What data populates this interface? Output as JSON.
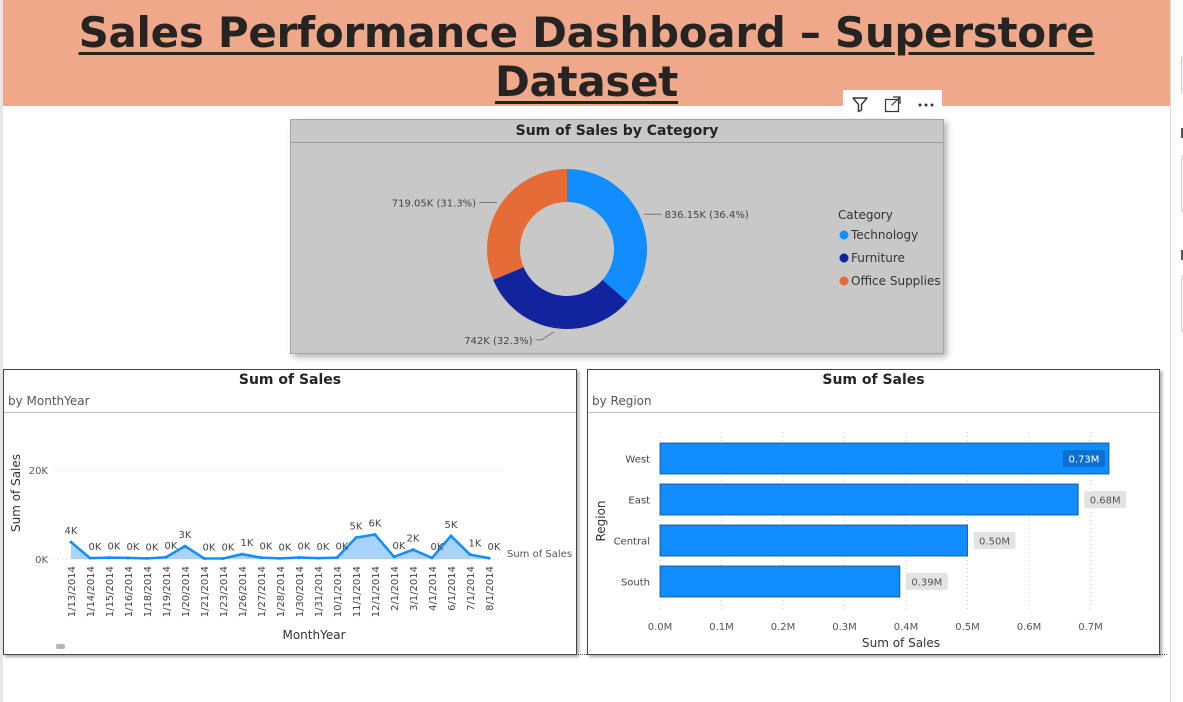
{
  "dashboard": {
    "title": "Sales Performance Dashboard – Superstore Dataset"
  },
  "colors": {
    "header": "#f0a88b",
    "technology": "#118dff",
    "furniture": "#12239e",
    "office_supplies": "#e66c37",
    "bar": "#118dff",
    "line_area": "#a9d3fb"
  },
  "toolbar": {
    "icons": [
      "filter-icon",
      "focus-mode-icon",
      "more-options-icon"
    ]
  },
  "chart_data": [
    {
      "type": "pie",
      "variant": "donut",
      "title": "Sum of Sales by Category",
      "legend": {
        "title": "Category",
        "placement": "right"
      },
      "slices": [
        {
          "name": "Technology",
          "value": 836.15,
          "display": "836.15K (36.4%)",
          "color": "#118dff"
        },
        {
          "name": "Furniture",
          "value": 742,
          "display": "742K (32.3%)",
          "color": "#12239e"
        },
        {
          "name": "Office Supplies",
          "value": 719.05,
          "display": "719.05K (31.3%)",
          "color": "#e66c37"
        }
      ]
    },
    {
      "type": "area",
      "title": "Sum of Sales",
      "subtitle": "by MonthYear",
      "xlabel": "MonthYear",
      "ylabel": "Sum of Sales",
      "series_label": "Sum of Sales",
      "yticks": [
        "0K",
        "20K"
      ],
      "ylim": [
        0,
        20000
      ],
      "grid": true,
      "categories": [
        "1/13/2014",
        "1/14/2014",
        "1/15/2014",
        "1/16/2014",
        "1/18/2014",
        "1/19/2014",
        "1/20/2014",
        "1/21/2014",
        "1/23/2014",
        "1/26/2014",
        "1/27/2014",
        "1/28/2014",
        "1/30/2014",
        "1/31/2014",
        "10/1/2014",
        "11/1/2014",
        "12/1/2014",
        "2/1/2014",
        "3/1/2014",
        "4/1/2014",
        "6/1/2014",
        "7/1/2014",
        "8/1/2014"
      ],
      "values": [
        3800,
        200,
        300,
        250,
        150,
        400,
        2900,
        150,
        100,
        1100,
        300,
        150,
        350,
        200,
        300,
        4800,
        5500,
        500,
        2100,
        250,
        5200,
        1000,
        200
      ],
      "data_labels": [
        "4K",
        "0K",
        "0K",
        "0K",
        "0K",
        "0K",
        "3K",
        "0K",
        "0K",
        "1K",
        "0K",
        "0K",
        "0K",
        "0K",
        "0K",
        "5K",
        "6K",
        "0K",
        "2K",
        "0K",
        "5K",
        "1K",
        "0K"
      ]
    },
    {
      "type": "bar",
      "orientation": "horizontal",
      "title": "Sum of Sales",
      "subtitle": "by Region",
      "xlabel": "Sum of Sales",
      "ylabel": "Region",
      "xlim": [
        0,
        0.7
      ],
      "xticks": [
        "0.0M",
        "0.1M",
        "0.2M",
        "0.3M",
        "0.4M",
        "0.5M",
        "0.6M",
        "0.7M"
      ],
      "grid": true,
      "categories": [
        "West",
        "East",
        "Central",
        "South"
      ],
      "values": [
        0.73,
        0.68,
        0.5,
        0.39
      ],
      "data_labels": [
        "0.73M",
        "0.68M",
        "0.50M",
        "0.39M"
      ]
    }
  ]
}
